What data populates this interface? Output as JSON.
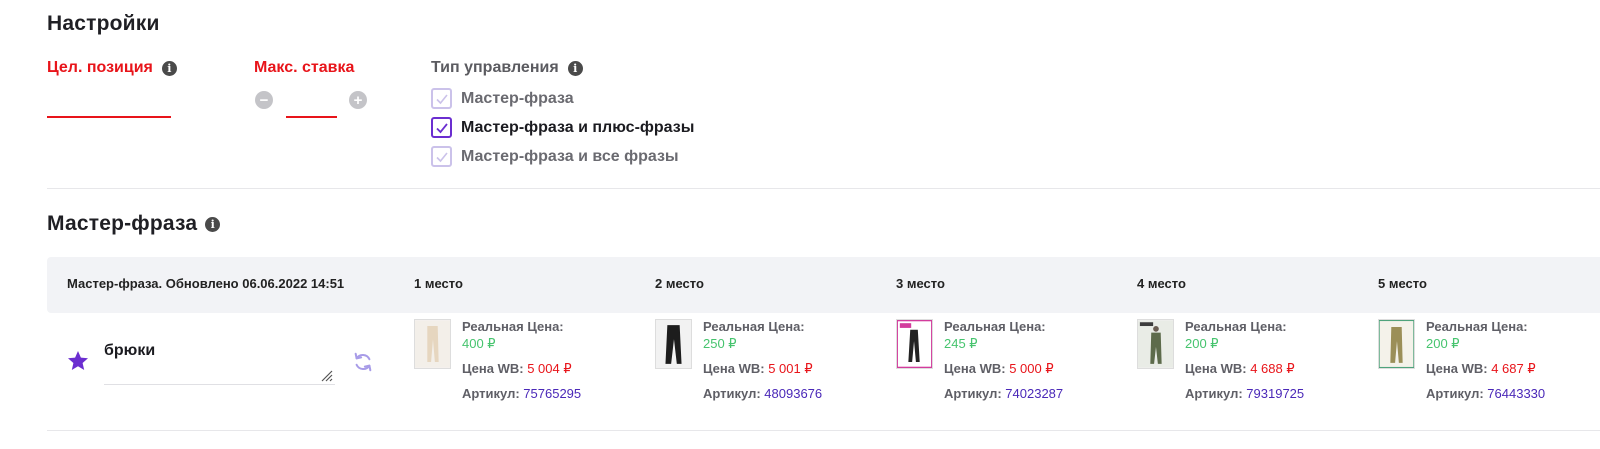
{
  "settings": {
    "title": "Настройки",
    "target_position_label": "Цел. позиция",
    "max_bid_label": "Макс. ставка",
    "control_type_label": "Тип управления",
    "target_position_value": "",
    "max_bid_value": "",
    "minus": "−",
    "plus": "+",
    "info_glyph": "i",
    "options": [
      {
        "label": "Мастер-фраза",
        "checked": false
      },
      {
        "label": "Мастер-фраза и плюс-фразы",
        "checked": true
      },
      {
        "label": "Мастер-фраза и все фразы",
        "checked": false
      }
    ]
  },
  "master": {
    "title": "Мастер-фраза",
    "header_updated": "Мастер-фраза. Обновлено 06.06.2022 14:51",
    "places": [
      "1 место",
      "2 место",
      "3 место",
      "4 место",
      "5 место"
    ],
    "phrase": "брюки",
    "accent_color": "#6b2ed0",
    "products": [
      {
        "real_price_label": "Реальная Цена:",
        "real_price": "400 ₽",
        "wb_label": "Цена WB:",
        "wb_price": "5 004 ₽",
        "article_label": "Артикул:",
        "article": "75765295"
      },
      {
        "real_price_label": "Реальная Цена:",
        "real_price": "250 ₽",
        "wb_label": "Цена WB:",
        "wb_price": "5 001 ₽",
        "article_label": "Артикул:",
        "article": "48093676"
      },
      {
        "real_price_label": "Реальная Цена:",
        "real_price": "245 ₽",
        "wb_label": "Цена WB:",
        "wb_price": "5 000 ₽",
        "article_label": "Артикул:",
        "article": "74023287"
      },
      {
        "real_price_label": "Реальная Цена:",
        "real_price": "200 ₽",
        "wb_label": "Цена WB:",
        "wb_price": "4 688 ₽",
        "article_label": "Артикул:",
        "article": "79319725"
      },
      {
        "real_price_label": "Реальная Цена:",
        "real_price": "200 ₽",
        "wb_label": "Цена WB:",
        "wb_price": "4 687 ₽",
        "article_label": "Артикул:",
        "article": "76443330"
      }
    ]
  }
}
